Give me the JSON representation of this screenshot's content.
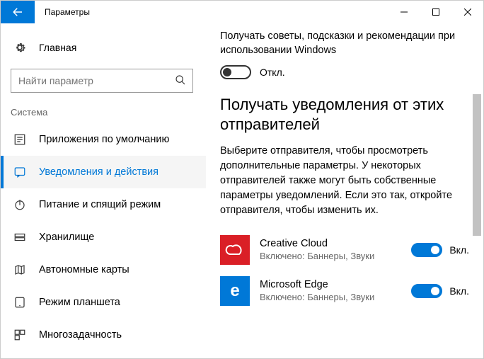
{
  "window": {
    "title": "Параметры"
  },
  "sidebar": {
    "home": "Главная",
    "search_placeholder": "Найти параметр",
    "group": "Система",
    "items": [
      {
        "label": "Приложения по умолчанию"
      },
      {
        "label": "Уведомления и действия"
      },
      {
        "label": "Питание и спящий режим"
      },
      {
        "label": "Хранилище"
      },
      {
        "label": "Автономные карты"
      },
      {
        "label": "Режим планшета"
      },
      {
        "label": "Многозадачность"
      }
    ]
  },
  "content": {
    "tips_title": "Получать советы, подсказки и рекомендации при использовании Windows",
    "tips_state": "Откл.",
    "senders_heading": "Получать уведомления от этих отправителей",
    "senders_desc": "Выберите отправителя, чтобы просмотреть дополнительные параметры. У некоторых отправителей также могут быть собственные параметры уведомлений. Если это так, откройте отправителя, чтобы изменить их.",
    "on_label": "Вкл.",
    "senders": [
      {
        "name": "Creative Cloud",
        "sub": "Включено: Баннеры, Звуки"
      },
      {
        "name": "Microsoft Edge",
        "sub": "Включено: Баннеры, Звуки"
      }
    ]
  }
}
